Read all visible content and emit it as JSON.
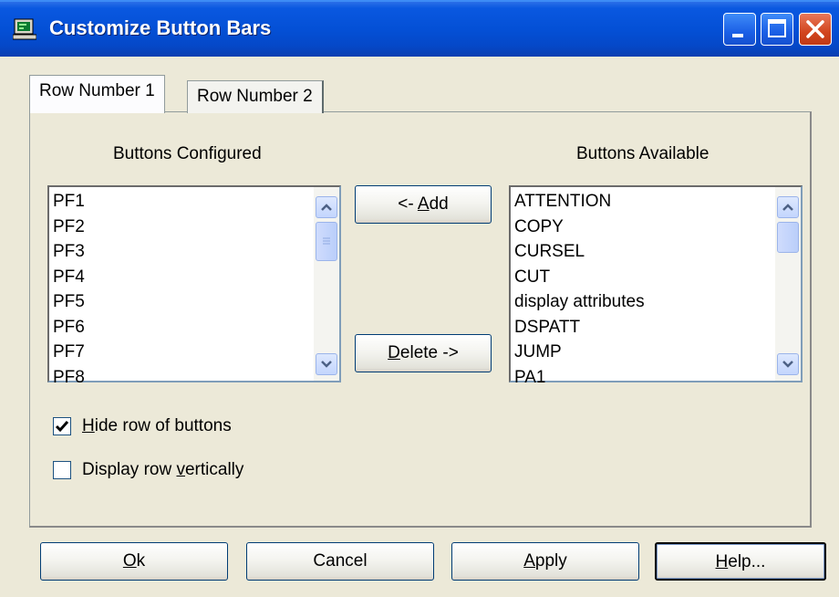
{
  "window": {
    "title": "Customize Button Bars",
    "title_bar_color": "#0450d6",
    "close_button_color": "#d2451e"
  },
  "tabs": [
    {
      "label": "Row Number 1",
      "selected": true
    },
    {
      "label": "Row Number 2",
      "selected": false
    }
  ],
  "configured": {
    "heading": "Buttons Configured",
    "items": [
      "PF1",
      "PF2",
      "PF3",
      "PF4",
      "PF5",
      "PF6",
      "PF7",
      "PF8"
    ]
  },
  "available": {
    "heading": "Buttons Available",
    "items": [
      "ATTENTION",
      "COPY",
      "CURSEL",
      "CUT",
      "display attributes",
      "DSPATT",
      "JUMP",
      "PA1"
    ]
  },
  "middle_buttons": {
    "add": {
      "prefix": "<- ",
      "underlined": "A",
      "rest": "dd"
    },
    "delete": {
      "underlined": "D",
      "rest": "elete ->"
    }
  },
  "options": {
    "hide_row": {
      "underlined": "H",
      "rest": "ide row of buttons",
      "checked": true
    },
    "display_vertical": {
      "prefix": "Display row ",
      "underlined": "v",
      "rest": "ertically",
      "checked": false
    }
  },
  "footer": {
    "ok": {
      "underlined": "O",
      "rest": "k"
    },
    "cancel": {
      "label": "Cancel"
    },
    "apply": {
      "underlined": "A",
      "rest": "pply"
    },
    "help": {
      "underlined": "H",
      "rest": "elp..."
    }
  },
  "icons": {
    "app": "terminal-icon",
    "minimize": "minimize-icon",
    "maximize": "maximize-icon",
    "close": "close-icon",
    "scroll_up": "chevron-up-icon",
    "scroll_down": "chevron-down-icon",
    "checkmark": "checkmark-icon"
  }
}
